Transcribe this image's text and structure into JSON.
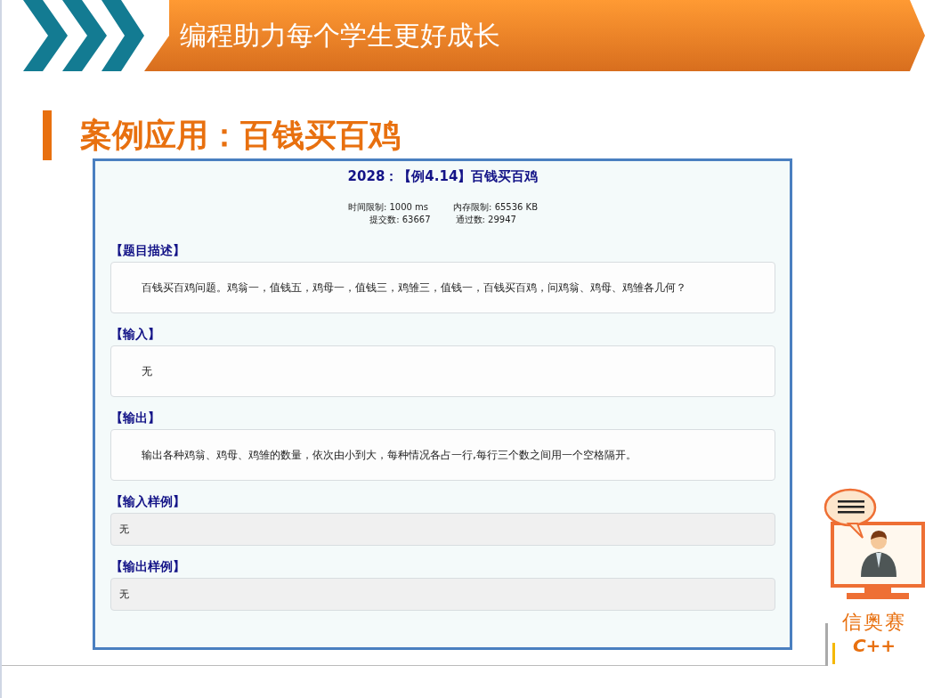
{
  "banner": {
    "title": "编程助力每个学生更好成长"
  },
  "heading": "案例应用：百钱买百鸡",
  "problem": {
    "title": "2028：【例4.14】百钱买百鸡",
    "limits": [
      "时间限制: 1000 ms",
      "内存限制: 65536 KB"
    ],
    "stats": [
      "提交数: 63667",
      "通过数: 29947"
    ],
    "sections": [
      {
        "kind": "text",
        "heading": "【题目描述】",
        "body": "百钱买百鸡问题。鸡翁一，值钱五，鸡母一，值钱三，鸡雏三，值钱一，百钱买百鸡，问鸡翁、鸡母、鸡雏各几何？"
      },
      {
        "kind": "text",
        "heading": "【输入】",
        "body": "无"
      },
      {
        "kind": "text",
        "heading": "【输出】",
        "body": "输出各种鸡翁、鸡母、鸡雏的数量，依次由小到大，每种情况各占一行,每行三个数之间用一个空格隔开。"
      },
      {
        "kind": "sample",
        "heading": "【输入样例】",
        "body": "无"
      },
      {
        "kind": "sample",
        "heading": "【输出样例】",
        "body": "无"
      }
    ]
  },
  "logo": {
    "line_1": "信奥赛",
    "line_2": "C++"
  }
}
